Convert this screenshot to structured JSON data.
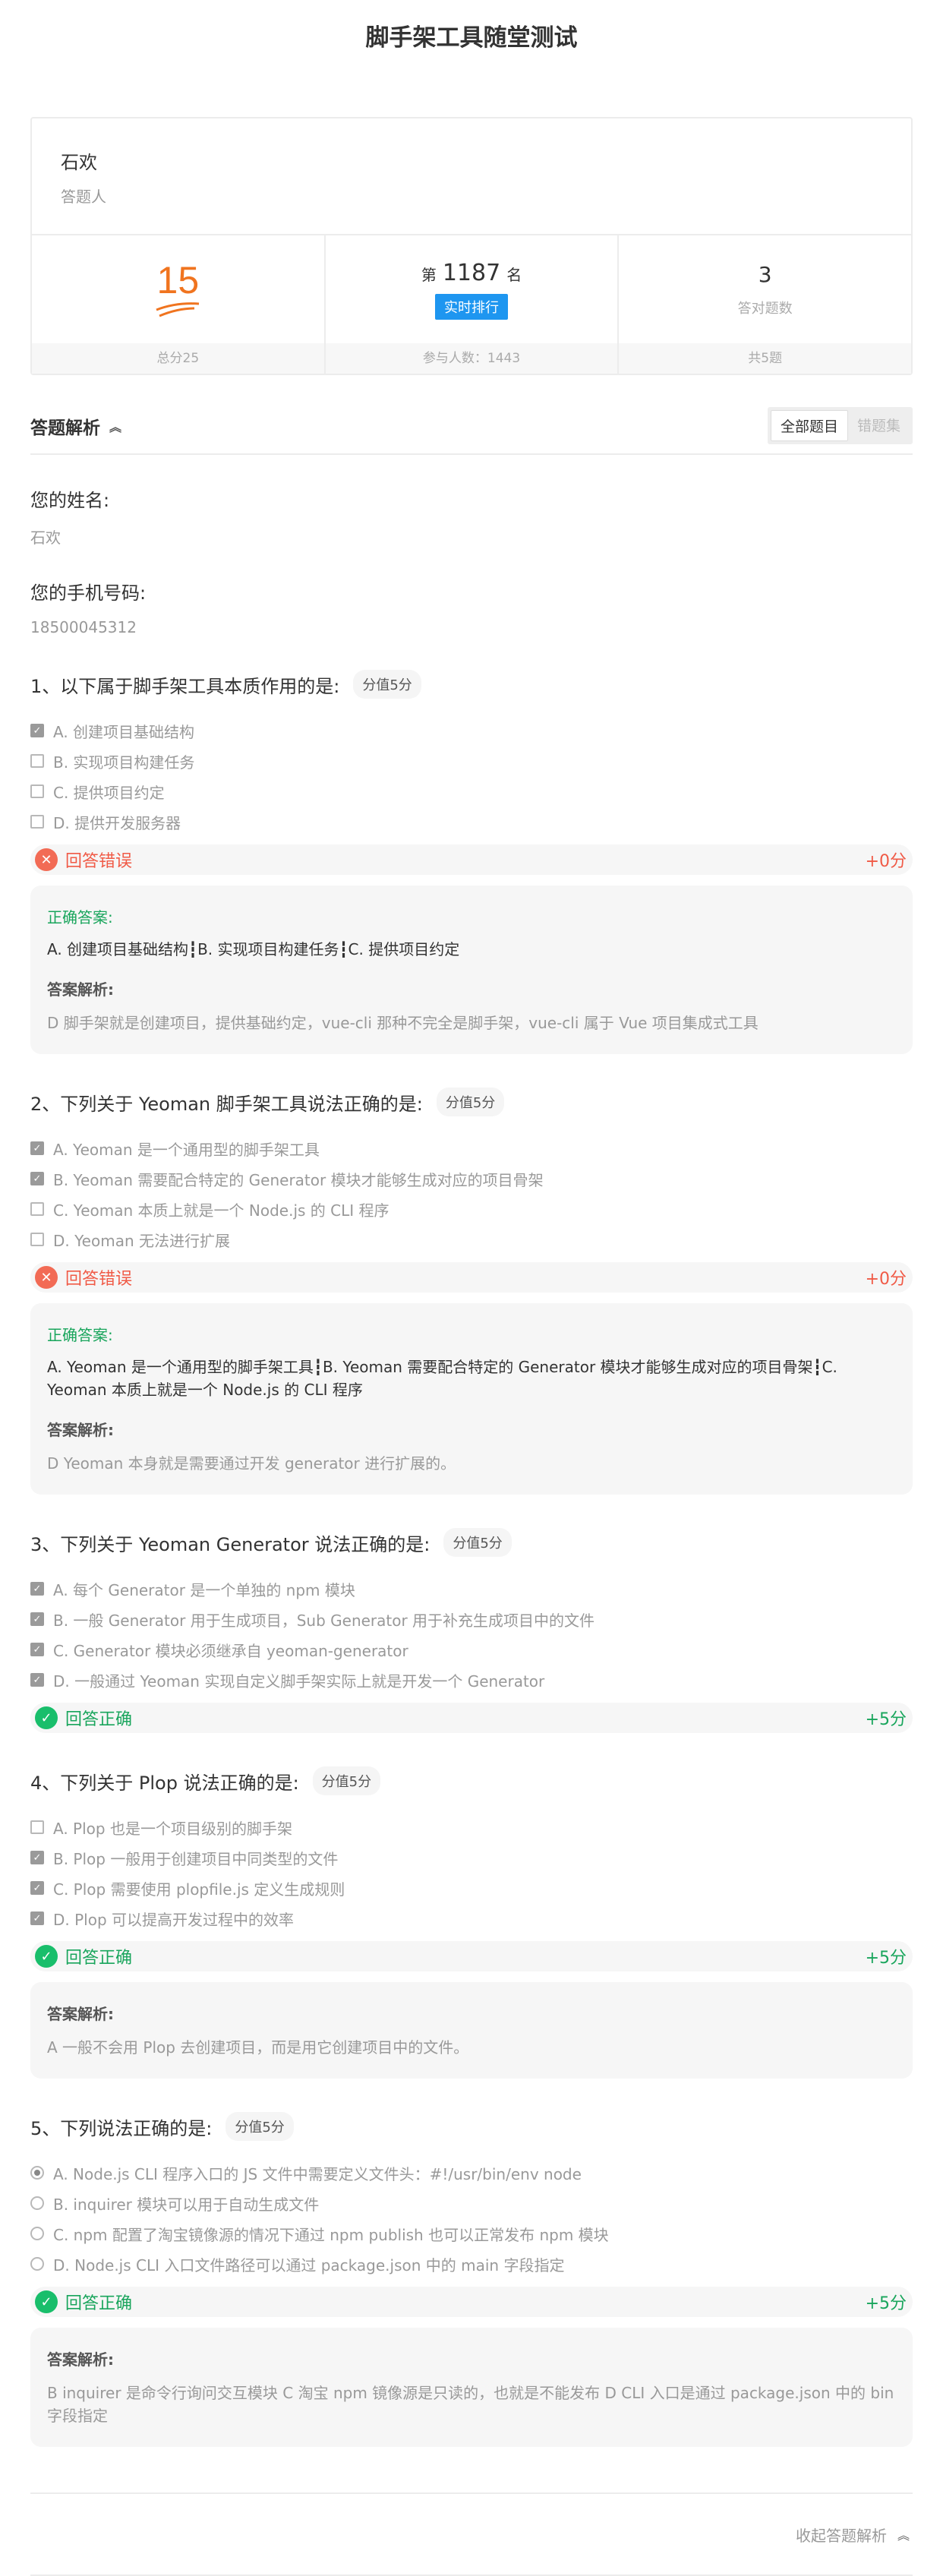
{
  "page_title": "脚手架工具随堂测试",
  "user": {
    "name": "石欢",
    "role": "答题人"
  },
  "stats": {
    "score": "15",
    "score_foot": "总分25",
    "rank_prefix": "第",
    "rank": "1187",
    "rank_suffix": "名",
    "rank_button": "实时排行",
    "rank_foot": "参与人数：1443",
    "correct_count": "3",
    "correct_label": "答对题数",
    "correct_foot": "共5题"
  },
  "analysis": {
    "title": "答题解析",
    "filter_all": "全部题目",
    "filter_wrong": "错题集"
  },
  "fields": [
    {
      "label": "您的姓名:",
      "value": "石欢"
    },
    {
      "label": "您的手机号码:",
      "value": "18500045312"
    }
  ],
  "questions": [
    {
      "title": "1、以下属于脚手架工具本质作用的是:",
      "score": "分值5分",
      "options": [
        {
          "text": "A. 创建项目基础结构",
          "checked": true
        },
        {
          "text": "B. 实现项目构建任务",
          "checked": false
        },
        {
          "text": "C. 提供项目约定",
          "checked": false
        },
        {
          "text": "D. 提供开发服务器",
          "checked": false
        }
      ],
      "result": "回答错误",
      "points": "+0分",
      "answer_label": "正确答案:",
      "answer": "A. 创建项目基础结构┇B. 实现项目构建任务┇C. 提供项目约定",
      "explain_label": "答案解析:",
      "explain": "D 脚手架就是创建项目，提供基础约定，vue-cli 那种不完全是脚手架，vue-cli 属于 Vue 项目集成式工具"
    },
    {
      "title": "2、下列关于 Yeoman 脚手架工具说法正确的是:",
      "score": "分值5分",
      "options": [
        {
          "text": "A. Yeoman 是一个通用型的脚手架工具",
          "checked": true
        },
        {
          "text": "B. Yeoman 需要配合特定的 Generator 模块才能够生成对应的项目骨架",
          "checked": true
        },
        {
          "text": "C. Yeoman 本质上就是一个 Node.js 的 CLI 程序",
          "checked": false
        },
        {
          "text": "D. Yeoman 无法进行扩展",
          "checked": false
        }
      ],
      "result": "回答错误",
      "points": "+0分",
      "answer_label": "正确答案:",
      "answer": "A. Yeoman 是一个通用型的脚手架工具┇B. Yeoman 需要配合特定的 Generator 模块才能够生成对应的项目骨架┇C. Yeoman 本质上就是一个 Node.js 的 CLI 程序",
      "explain_label": "答案解析:",
      "explain": "D Yeoman 本身就是需要通过开发 generator 进行扩展的。"
    },
    {
      "title": "3、下列关于 Yeoman Generator 说法正确的是:",
      "score": "分值5分",
      "options": [
        {
          "text": "A. 每个 Generator 是一个单独的 npm 模块",
          "checked": true
        },
        {
          "text": "B. 一般 Generator 用于生成项目，Sub Generator 用于补充生成项目中的文件",
          "checked": true
        },
        {
          "text": "C. Generator 模块必须继承自 yeoman-generator",
          "checked": true
        },
        {
          "text": "D. 一般通过 Yeoman 实现自定义脚手架实际上就是开发一个 Generator",
          "checked": true
        }
      ],
      "result": "回答正确",
      "points": "+5分"
    },
    {
      "title": "4、下列关于 Plop 说法正确的是:",
      "score": "分值5分",
      "options": [
        {
          "text": "A. Plop 也是一个项目级别的脚手架",
          "checked": false
        },
        {
          "text": "B. Plop 一般用于创建项目中同类型的文件",
          "checked": true
        },
        {
          "text": "C. Plop 需要使用 plopfile.js 定义生成规则",
          "checked": true
        },
        {
          "text": "D. Plop 可以提高开发过程中的效率",
          "checked": true
        }
      ],
      "result": "回答正确",
      "points": "+5分",
      "explain_label": "答案解析:",
      "explain": "A 一般不会用 Plop 去创建项目，而是用它创建项目中的文件。"
    },
    {
      "title": "5、下列说法正确的是:",
      "score": "分值5分",
      "options": [
        {
          "text": "A. Node.js CLI 程序入口的 JS 文件中需要定义文件头：#!/usr/bin/env node",
          "checked": true
        },
        {
          "text": "B. inquirer 模块可以用于自动生成文件",
          "checked": false
        },
        {
          "text": "C. npm 配置了淘宝镜像源的情况下通过 npm publish 也可以正常发布 npm 模块",
          "checked": false
        },
        {
          "text": "D. Node.js CLI 入口文件路径可以通过 package.json 中的 main 字段指定",
          "checked": false
        }
      ],
      "result": "回答正确",
      "points": "+5分",
      "explain_label": "答案解析:",
      "explain": "B inquirer 是命令行询问交互模块 C 淘宝 npm 镜像源是只读的，也就是不能发布 D CLI 入口是通过 package.json 中的 bin 字段指定"
    }
  ],
  "footer": {
    "collapse": "收起答题解析"
  },
  "colors": {
    "accent": "#f0741f",
    "blue": "#1e96f0",
    "correct": "#19a55c",
    "wrong": "#f05a46"
  }
}
